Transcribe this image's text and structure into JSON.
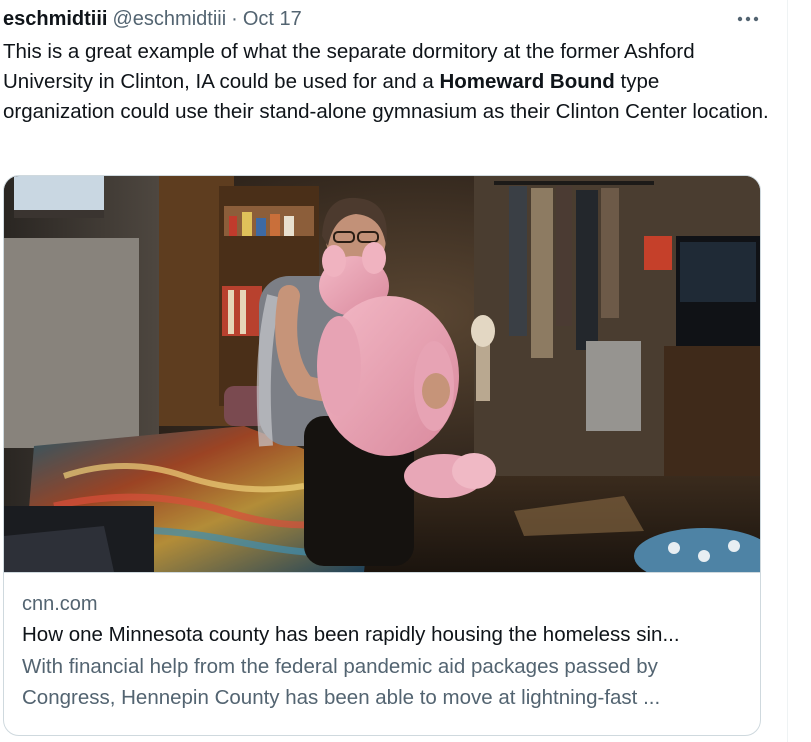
{
  "tweet": {
    "display_name": "eschmidtiii",
    "handle": "@eschmidtiii",
    "separator": "·",
    "timestamp": "Oct 17",
    "more_icon": "more-horizontal-icon",
    "text_part1": "This is a great example of what the separate dormitory at the former Ashford University in Clinton, IA could be used for and a ",
    "text_bold": "Homeward Bound",
    "text_part2": " type organization could use their stand-alone gymnasium as their Clinton Center location."
  },
  "card": {
    "domain": "cnn.com",
    "title": "How one Minnesota county has been rapidly housing the homeless sin...",
    "description_line1": "With financial help from the federal pandemic aid packages passed by",
    "description_line2": "Congress, Hennepin County has been able to move at lightning-fast ..."
  },
  "colors": {
    "text_primary": "#0f1419",
    "text_secondary": "#536471",
    "border": "#cfd9de"
  }
}
